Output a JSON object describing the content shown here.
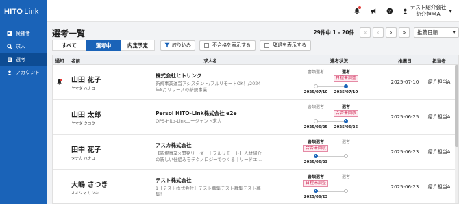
{
  "app": {
    "logo_main": "HITO",
    "logo_sub": "Link"
  },
  "sidebar": {
    "items": [
      {
        "label": "候補者",
        "active": false
      },
      {
        "label": "求人",
        "active": false
      },
      {
        "label": "選考",
        "active": true
      },
      {
        "label": "アカウント",
        "active": false
      }
    ]
  },
  "header": {
    "company": "テスト紹介会社",
    "user": "紹介担当A"
  },
  "page": {
    "title": "選考一覧"
  },
  "pagination": {
    "count": "29件中 1 - 20件",
    "first": "«",
    "prev": "‹",
    "next": "›",
    "last": "»"
  },
  "sort": {
    "selected": "推薦日順"
  },
  "tabs": [
    {
      "label": "すべて",
      "active": false
    },
    {
      "label": "選考中",
      "active": true
    },
    {
      "label": "内定予定",
      "active": false
    }
  ],
  "filters": {
    "narrow": "絞り込み",
    "show_fail": "不合格を表示する",
    "show_decline": "辞退を表示する"
  },
  "columns": {
    "notice": "通知",
    "name": "名前",
    "job": "求人名",
    "status": "選考状況",
    "recommend_date": "推薦日",
    "owner": "担当者"
  },
  "rows": [
    {
      "notice": true,
      "name": "山田 花子",
      "kana": "ヤマダ ハナコ",
      "company": "株式会社ヒトリンク",
      "job": "新規事業運営アシスタント/フルリモートOK！/2024年8月リリースの新規事業",
      "stage1": "書類選考",
      "stage2": "選考",
      "tag": "日程未調整",
      "current": 2,
      "date1": "2025/07/10",
      "date2": "2025/07/10",
      "recommend_date": "2025-07-10",
      "owner": "紹介担当A"
    },
    {
      "notice": false,
      "name": "山田 太郎",
      "kana": "ヤマダ タロウ",
      "company": "Persol HITO-Link株式会社 e2e",
      "job": "OPS-Hito-Linkエージェント求人",
      "stage1": "書類選考",
      "stage2": "選考",
      "tag": "合否未回収",
      "current": 2,
      "date1": "2025/06/25",
      "date2": "2025/06/25",
      "recommend_date": "2025-06-25",
      "owner": "紹介担当A"
    },
    {
      "notice": false,
      "name": "田中 花子",
      "kana": "タナカ ハナコ",
      "company": "アスカ株式会社",
      "job": "【新規事業×開発リーダー｜フルリモート】人材紹介の新しい仕組みをテクノロジーでつくる｜リードエ…",
      "stage1": "書類選考",
      "stage2": "選考",
      "tag": "合否未回収",
      "current": 1,
      "date1": "2025/06/23",
      "date2": "",
      "recommend_date": "2025-06-23",
      "owner": "紹介担当A"
    },
    {
      "notice": false,
      "name": "大嶋 さつき",
      "kana": "オオシマ サツキ",
      "company": "テスト株式会社",
      "job": "1【テスト株式会社】テスト募集テスト募集テスト募集！",
      "stage1": "書類選考",
      "stage2": "選考",
      "tag": "日程未調整",
      "current": 1,
      "date1": "2025/06/23",
      "date2": "",
      "recommend_date": "2025-06-23",
      "owner": "紹介担当A"
    }
  ]
}
